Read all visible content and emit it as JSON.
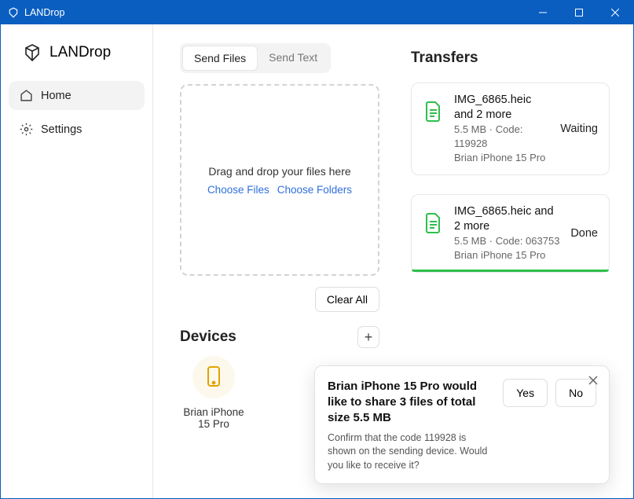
{
  "window": {
    "title": "LANDrop"
  },
  "brand": {
    "name": "LANDrop"
  },
  "nav": {
    "home": "Home",
    "settings": "Settings"
  },
  "tabs": {
    "send_files": "Send Files",
    "send_text": "Send Text"
  },
  "dropzone": {
    "headline": "Drag and drop your files here",
    "choose_files": "Choose Files",
    "choose_folders": "Choose Folders"
  },
  "buttons": {
    "clear_all": "Clear All",
    "add": "+"
  },
  "sections": {
    "devices": "Devices",
    "transfers": "Transfers"
  },
  "devices": [
    {
      "name": "Brian iPhone 15 Pro"
    }
  ],
  "transfers": [
    {
      "title": "IMG_6865.heic and 2 more",
      "meta": "5.5 MB · Code: 119928",
      "from": "Brian iPhone 15 Pro",
      "status": "Waiting",
      "progress_pct": 0
    },
    {
      "title": "IMG_6865.heic and 2 more",
      "meta": "5.5 MB · Code: 063753",
      "from": "Brian iPhone 15 Pro",
      "status": "Done",
      "progress_pct": 100
    }
  ],
  "popup": {
    "title": "Brian iPhone 15 Pro would like to share 3 files of total size 5.5 MB",
    "desc": "Confirm that the code 119928 is shown on the sending device. Would you like to receive it?",
    "yes": "Yes",
    "no": "No"
  }
}
